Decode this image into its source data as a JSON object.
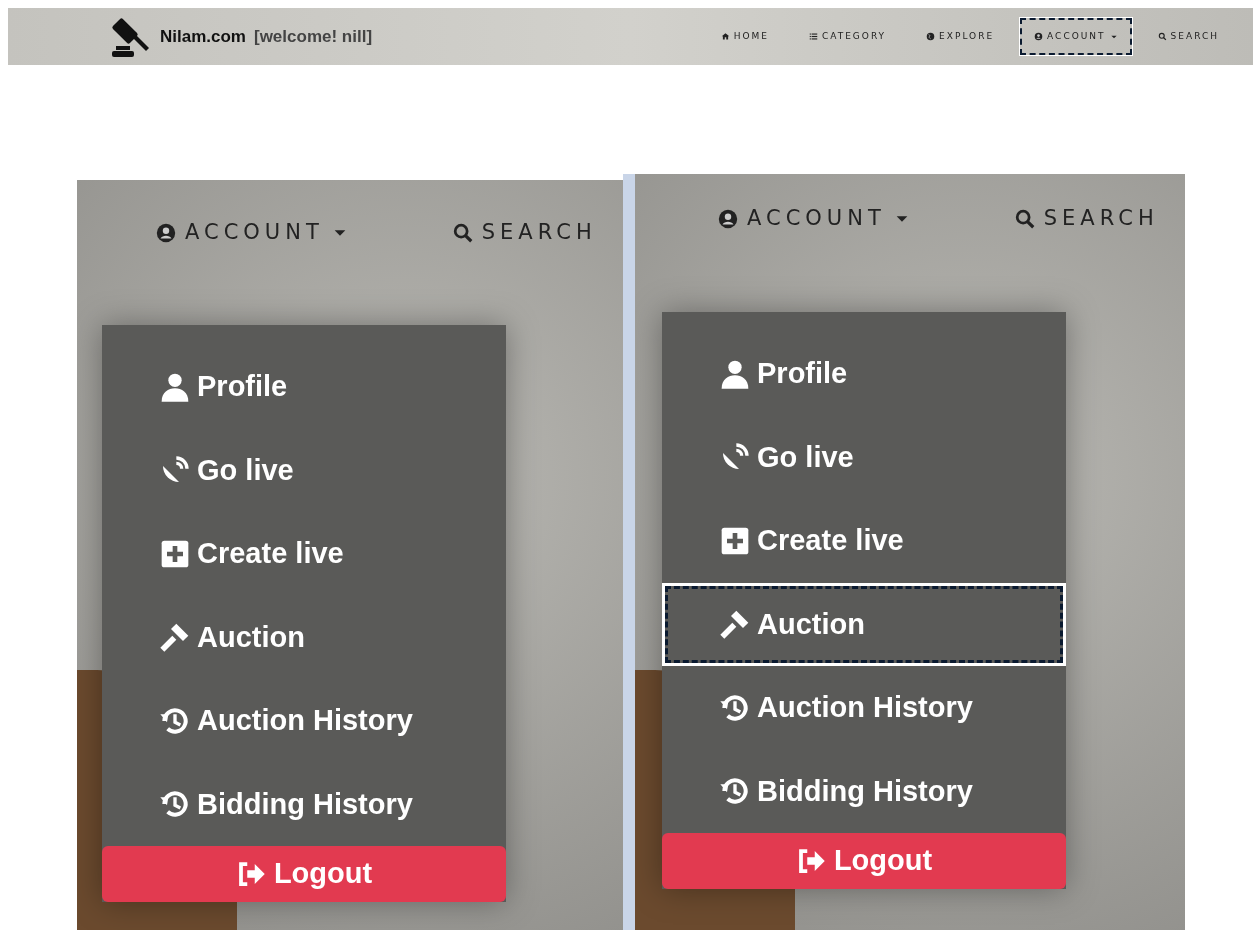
{
  "navbar": {
    "brand": "Nilam.com",
    "welcome": "[welcome! nill]",
    "items": [
      {
        "label": "HOME",
        "kind": "home",
        "caret": false,
        "selected": false
      },
      {
        "label": "CATEGORY",
        "kind": "list",
        "caret": false,
        "selected": false
      },
      {
        "label": "EXPLORE",
        "kind": "globe",
        "caret": false,
        "selected": false
      },
      {
        "label": "ACCOUNT",
        "kind": "user-circle",
        "caret": true,
        "selected": true
      },
      {
        "label": "SEARCH",
        "kind": "search",
        "caret": false,
        "selected": false
      }
    ]
  },
  "panels": [
    {
      "nav": [
        {
          "label": "ACCOUNT",
          "kind": "user-circle",
          "caret": true
        },
        {
          "label": "SEARCH",
          "kind": "search",
          "caret": false
        }
      ],
      "menu": [
        {
          "label": "Profile",
          "kind": "user",
          "selected": false
        },
        {
          "label": "Go live",
          "kind": "satellite",
          "selected": false
        },
        {
          "label": "Create live",
          "kind": "plus",
          "selected": false
        },
        {
          "label": "Auction",
          "kind": "gavel",
          "selected": false
        },
        {
          "label": "Auction History",
          "kind": "history",
          "selected": false
        },
        {
          "label": "Bidding History",
          "kind": "history",
          "selected": false
        }
      ],
      "logout": "Logout"
    },
    {
      "nav": [
        {
          "label": "ACCOUNT",
          "kind": "user-circle",
          "caret": true
        },
        {
          "label": "SEARCH",
          "kind": "search",
          "caret": false
        }
      ],
      "menu": [
        {
          "label": "Profile",
          "kind": "user",
          "selected": false
        },
        {
          "label": "Go live",
          "kind": "satellite",
          "selected": false
        },
        {
          "label": "Create live",
          "kind": "plus",
          "selected": false
        },
        {
          "label": "Auction",
          "kind": "gavel",
          "selected": true
        },
        {
          "label": "Auction History",
          "kind": "history",
          "selected": false
        },
        {
          "label": "Bidding History",
          "kind": "history",
          "selected": false
        }
      ],
      "logout": "Logout"
    }
  ]
}
